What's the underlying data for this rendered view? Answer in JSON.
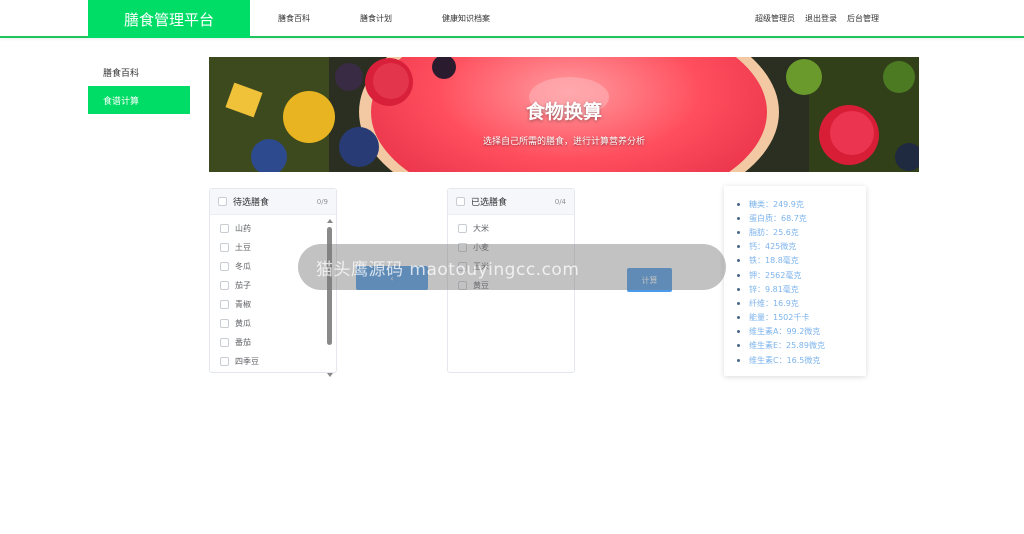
{
  "header": {
    "logo": "膳食管理平台",
    "nav": [
      "膳食百科",
      "膳食计划",
      "健康知识档案"
    ],
    "user_links": [
      "超级管理员",
      "退出登录",
      "后台管理"
    ]
  },
  "sidebar": {
    "items": [
      {
        "label": "膳食百科",
        "active": false
      },
      {
        "label": "食谱计算",
        "active": true
      }
    ]
  },
  "banner": {
    "title": "食物换算",
    "subtitle": "选择自己所需的膳食，进行计算营养分析"
  },
  "transfer": {
    "left": {
      "title": "待选膳食",
      "count": "0/9",
      "items": [
        "山药",
        "土豆",
        "冬瓜",
        "茄子",
        "青椒",
        "黄瓜",
        "番茄",
        "四季豆"
      ]
    },
    "right": {
      "title": "已选膳食",
      "count": "0/4",
      "items": [
        "大米",
        "小麦",
        "玉米",
        "黄豆"
      ]
    },
    "transfer_button": "‹",
    "calc_button": "计算"
  },
  "result": {
    "items": [
      "糖类：249.9克",
      "蛋白质：68.7克",
      "脂肪：25.6克",
      "钙：425微克",
      "铁：18.8毫克",
      "钾：2562毫克",
      "锌：9.81毫克",
      "纤维：16.9克",
      "能量：1502千卡",
      "维生素A：99.2微克",
      "维生素E：25.89微克",
      "维生素C：16.5微克"
    ]
  },
  "watermark": "猫头鹰源码 maotouyingcc.com",
  "colors": {
    "brand": "#00dd66",
    "button": "#4c9bea",
    "result_text": "#7db4ec"
  }
}
